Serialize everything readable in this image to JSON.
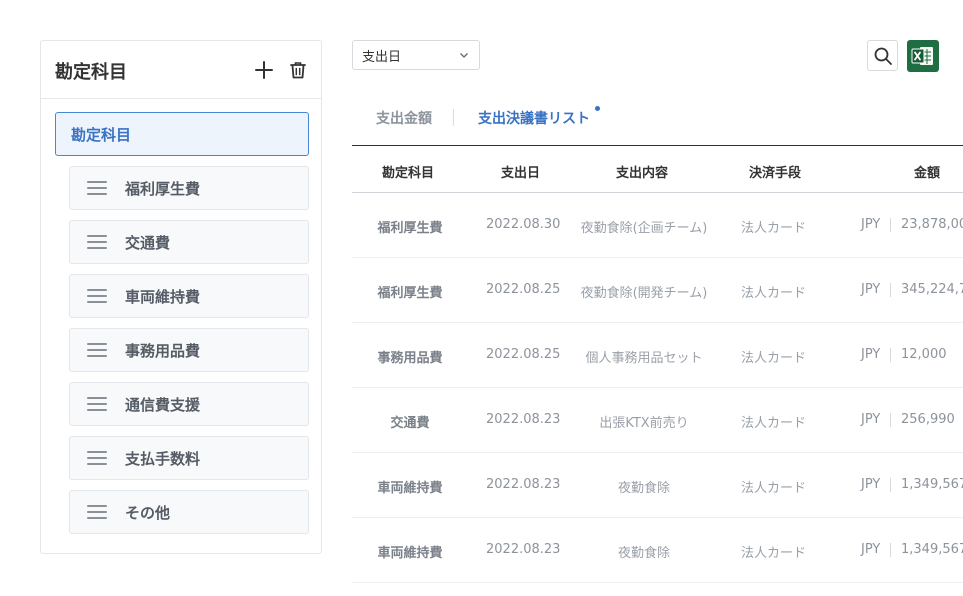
{
  "sidebar": {
    "title": "勘定科目",
    "root_label": "勘定科目",
    "items": [
      {
        "label": "福利厚生費"
      },
      {
        "label": "交通費"
      },
      {
        "label": "車両維持費"
      },
      {
        "label": "事務用品費"
      },
      {
        "label": "通信費支援"
      },
      {
        "label": "支払手数料"
      },
      {
        "label": "その他"
      }
    ]
  },
  "toolbar": {
    "date_select_value": "支出日"
  },
  "tabs": [
    {
      "label": "支出金額"
    },
    {
      "label": "支出決議書リスト"
    }
  ],
  "table": {
    "headers": [
      "勘定科目",
      "支出日",
      "支出内容",
      "決済手段",
      "金額"
    ],
    "rows": [
      {
        "account": "福利厚生費",
        "date": "2022.08.30",
        "content": "夜勤食除(企画チーム)",
        "method": "法人カード",
        "currency": "JPY",
        "amount": "23,878,00"
      },
      {
        "account": "福利厚生費",
        "date": "2022.08.25",
        "content": "夜勤食除(開発チーム)",
        "method": "法人カード",
        "currency": "JPY",
        "amount": "345,224,7"
      },
      {
        "account": "事務用品費",
        "date": "2022.08.25",
        "content": "個人事務用品セット",
        "method": "法人カード",
        "currency": "JPY",
        "amount": "12,000"
      },
      {
        "account": "交通費",
        "date": "2022.08.23",
        "content": "出張KTX前売り",
        "method": "法人カード",
        "currency": "JPY",
        "amount": "256,990"
      },
      {
        "account": "車両維持費",
        "date": "2022.08.23",
        "content": "夜勤食除",
        "method": "法人カード",
        "currency": "JPY",
        "amount": "1,349,567"
      },
      {
        "account": "車両維持費",
        "date": "2022.08.23",
        "content": "夜勤食除",
        "method": "法人カード",
        "currency": "JPY",
        "amount": "1,349,567"
      }
    ]
  },
  "colors": {
    "accent": "#3a72c4",
    "excel_green": "#1f6e43"
  }
}
